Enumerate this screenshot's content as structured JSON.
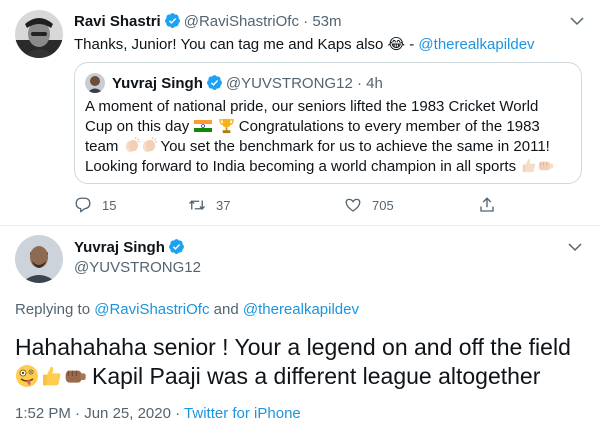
{
  "reply_tweet": {
    "display_name": "Ravi Shastri",
    "handle": "@RaviShastriOfc",
    "separator": "·",
    "time_ago": "53m",
    "text_before": "Thanks, Junior! You can tag me and Kaps also",
    "text_emoji": "😂",
    "text_dash": " - ",
    "mention": "@therealkapildev",
    "quoted": {
      "display_name": "Yuvraj Singh",
      "handle": "@YUVSTRONG12",
      "separator": "·",
      "time_ago": "4h",
      "line1": "A moment of national pride, our seniors lifted the 1983 Cricket World",
      "line2_start": "Cup on this day",
      "line2_end": "Congratulations to every member of the 1983",
      "line3_start": "team",
      "line3_end": "You set the benchmark for us to achieve the same in 2011!",
      "line4": "Looking forward to India becoming a world champion in all sports"
    },
    "actions": {
      "reply_count": "15",
      "retweet_count": "37",
      "like_count": "705"
    }
  },
  "main_tweet": {
    "display_name": "Yuvraj Singh",
    "handle": "@YUVSTRONG12",
    "replying_prefix": "Replying to",
    "replying_mention1": "@RaviShastriOfc",
    "replying_and": "and",
    "replying_mention2": "@therealkapildev",
    "line1": "Hahahahaha senior ! Your a legend on and off the field",
    "line2": "Kapil Paaji was a different league altogether",
    "time": "1:52 PM",
    "separator1": "·",
    "date": "Jun 25, 2020",
    "separator2": "·",
    "source": "Twitter for iPhone"
  },
  "colors": {
    "link": "#1b95e0",
    "muted": "#536471",
    "border": "#cfd9de",
    "verified": "#1da1f2"
  },
  "icons": [
    "verified-badge-icon",
    "caret-down-icon",
    "reply-icon",
    "retweet-icon",
    "like-icon",
    "share-icon",
    "india-flag-emoji",
    "trophy-emoji",
    "clap-emoji",
    "thumbs-up-emoji",
    "fist-bump-emoji",
    "zany-face-emoji",
    "laughing-tears-emoji"
  ]
}
